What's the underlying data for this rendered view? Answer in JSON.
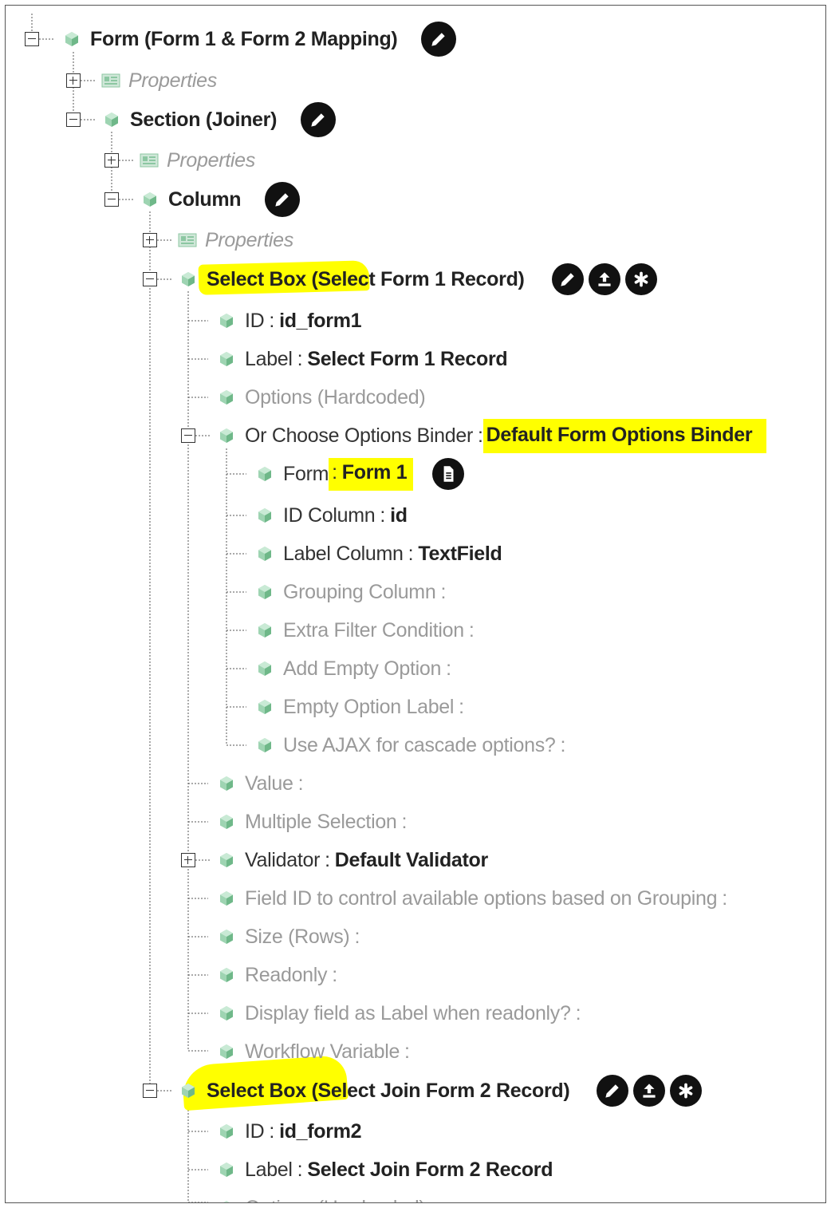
{
  "colors": {
    "highlight": "#ffff00",
    "node_green": "#7fc69b",
    "text_dark": "#222222",
    "text_grey": "#9a9a9a"
  },
  "tree": {
    "form": {
      "label": "Form (Form 1 & Form 2 Mapping)",
      "properties": "Properties"
    },
    "section": {
      "label": "Section (Joiner)",
      "properties": "Properties"
    },
    "column": {
      "label": "Column",
      "properties": "Properties"
    },
    "select1": {
      "label": "Select Box (Select Form 1 Record)",
      "id_key": "ID",
      "id_val": "id_form1",
      "label_key": "Label",
      "label_val": "Select Form 1 Record",
      "options": "Options (Hardcoded)",
      "binder_key": "Or Choose Options Binder",
      "binder_val": "Default Form Options Binder",
      "binder_fields": {
        "form_key": "Form",
        "form_val": "Form 1",
        "idcol_key": "ID Column",
        "idcol_val": "id",
        "labelcol_key": "Label Column",
        "labelcol_val": "TextField",
        "grouping": "Grouping Column",
        "extra_filter": "Extra Filter Condition",
        "add_empty": "Add Empty Option",
        "empty_label": "Empty Option Label",
        "ajax": "Use AJAX for cascade options?"
      },
      "value": "Value",
      "multiple": "Multiple Selection",
      "validator_key": "Validator",
      "validator_val": "Default Validator",
      "field_id_grouping": "Field ID to control available options based on Grouping",
      "size": "Size (Rows)",
      "readonly": "Readonly",
      "display_label": "Display field as Label when readonly?",
      "workflow_var": "Workflow Variable"
    },
    "select2": {
      "label": "Select Box (Select Join Form 2 Record)",
      "id_key": "ID",
      "id_val": "id_form2",
      "label_key": "Label",
      "label_val": "Select Join Form 2 Record",
      "options": "Options (Hardcoded)"
    },
    "colon": ":"
  },
  "icons": {
    "edit": "pencil-icon",
    "upload": "upload-icon",
    "asterisk": "asterisk-icon",
    "document": "document-icon",
    "node": "cube-icon",
    "properties": "properties-card-icon"
  }
}
